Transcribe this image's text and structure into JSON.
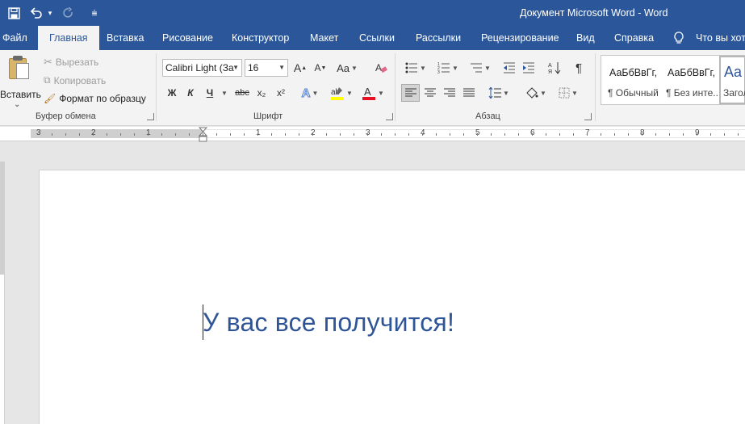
{
  "window": {
    "title": "Документ Microsoft Word  -  Word"
  },
  "qat": {
    "undo_dd": "▾",
    "customize": "⩧"
  },
  "tabs": [
    {
      "label": "Файл"
    },
    {
      "label": "Главная"
    },
    {
      "label": "Вставка"
    },
    {
      "label": "Рисование"
    },
    {
      "label": "Конструктор"
    },
    {
      "label": "Макет"
    },
    {
      "label": "Ссылки"
    },
    {
      "label": "Рассылки"
    },
    {
      "label": "Рецензирование"
    },
    {
      "label": "Вид"
    },
    {
      "label": "Справка"
    }
  ],
  "tell_me": {
    "label": "Что вы хот"
  },
  "clipboard": {
    "paste_label": "Вставить",
    "cut_label": "Вырезать",
    "copy_label": "Копировать",
    "format_painter_label": "Формат по образцу",
    "group_label": "Буфер обмена"
  },
  "font": {
    "font_name": "Calibri Light (За",
    "font_size": "16",
    "bold": "Ж",
    "italic": "К",
    "underline": "Ч",
    "strike": "abc",
    "subscript": "x₂",
    "superscript": "x²",
    "grow": "A",
    "shrink": "A",
    "case": "Aa",
    "group_label": "Шрифт",
    "highlight_color": "#ffff00",
    "font_color": "#e81123"
  },
  "paragraph": {
    "group_label": "Абзац"
  },
  "styles": [
    {
      "preview": "АаБбВвГг,",
      "name": "¶ Обычный"
    },
    {
      "preview": "АаБбВвГг,",
      "name": "¶ Без инте..."
    },
    {
      "preview": "Aa",
      "name": "Загол"
    }
  ],
  "ruler": {
    "numbers": [
      "3",
      "2",
      "1",
      "1",
      "2",
      "3",
      "4",
      "5",
      "6",
      "7",
      "8",
      "9"
    ]
  },
  "document": {
    "text": "У вас все получится!",
    "text_color": "#2f5597"
  },
  "colors": {
    "accent": "#2b579a",
    "ribbon_bg": "#f3f3f3"
  }
}
